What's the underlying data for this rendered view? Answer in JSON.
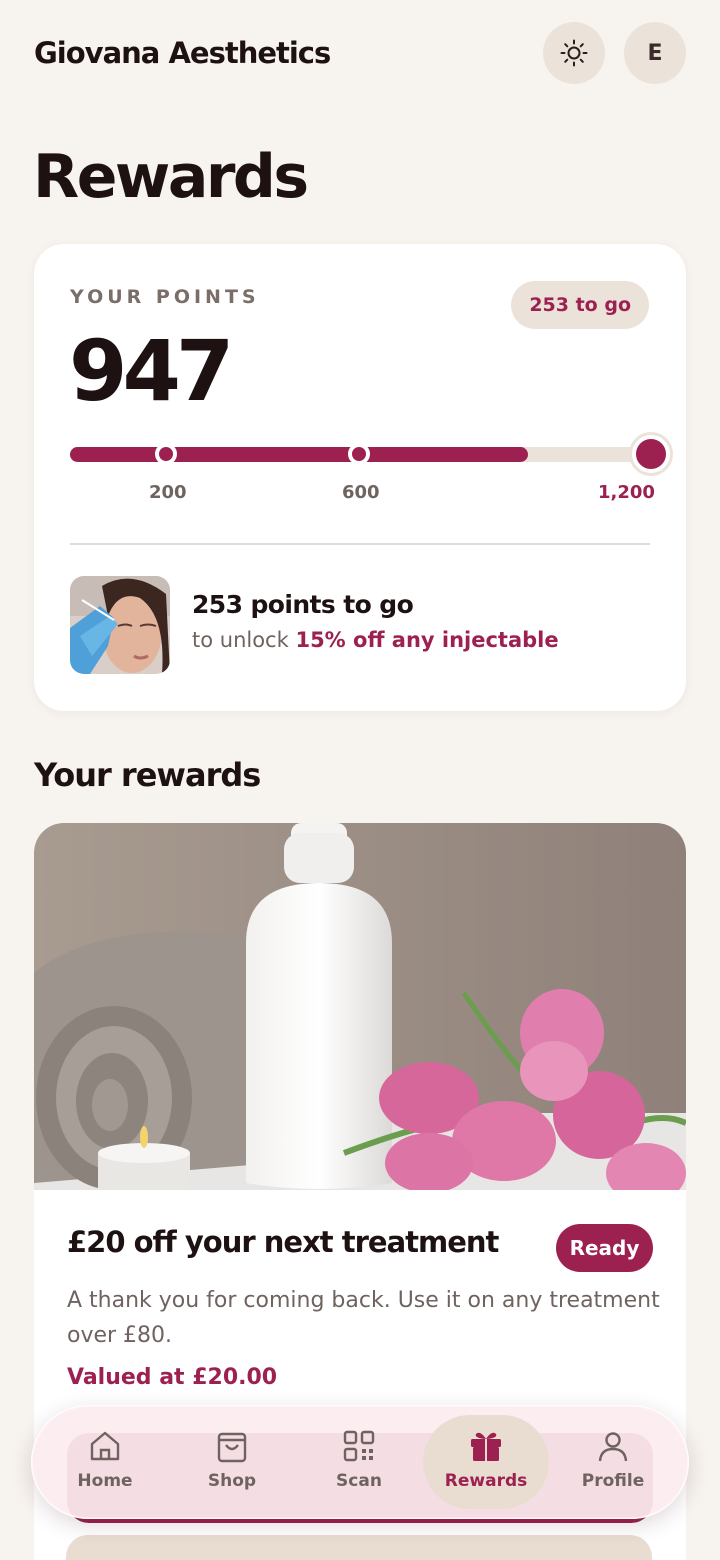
{
  "header": {
    "brand": "Giovana Aesthetics",
    "theme_icon": "sun-icon",
    "avatar_initial": "E"
  },
  "page_title": "Rewards",
  "points_card": {
    "label": "YOUR POINTS",
    "points": "947",
    "togo_badge": "253 to go",
    "progress_fraction": 0.79,
    "milestones": [
      "200",
      "600",
      "1,200"
    ],
    "unlock_title": "253 points to go",
    "unlock_prefix": "to unlock ",
    "unlock_highlight": "15% off any injectable"
  },
  "rewards_section": {
    "title": "Your rewards",
    "items": [
      {
        "title": "£20 off your next treatment",
        "status": "Ready",
        "description": "A thank you for coming back. Use it on any treatment over £80.",
        "value": "Valued at £20.00"
      }
    ]
  },
  "nav": {
    "items": [
      {
        "label": "Home",
        "icon": "home-icon"
      },
      {
        "label": "Shop",
        "icon": "shopping-bag-icon"
      },
      {
        "label": "Scan",
        "icon": "qr-code-icon"
      },
      {
        "label": "Rewards",
        "icon": "gift-icon"
      },
      {
        "label": "Profile",
        "icon": "user-icon"
      }
    ],
    "active": "Rewards"
  },
  "colors": {
    "accent": "#9c2150",
    "background": "#f7f3ee",
    "surface": "#ffffff",
    "chip": "#ebe3d9"
  }
}
